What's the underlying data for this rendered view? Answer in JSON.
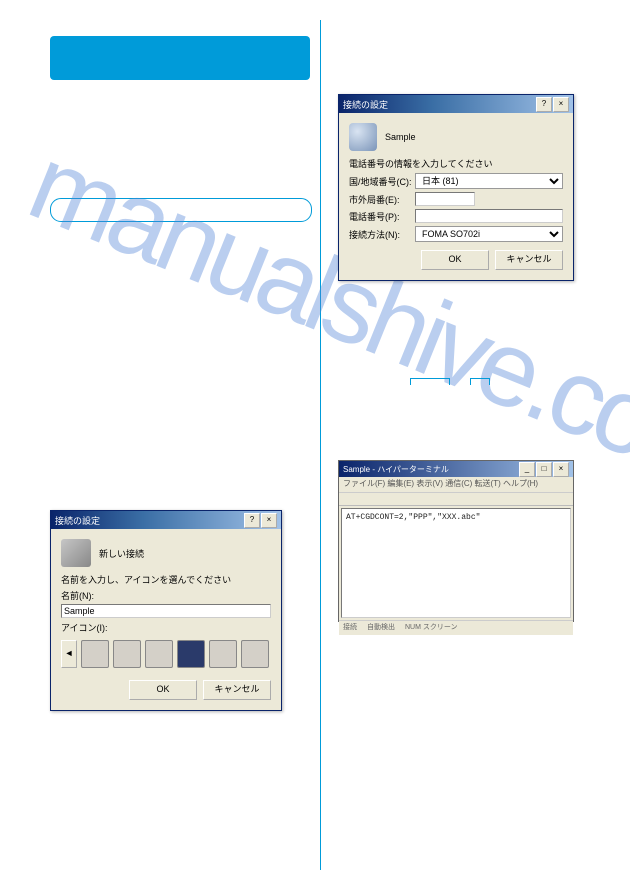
{
  "watermark": "manualshive.com",
  "dialog1": {
    "title": "接続の設定",
    "header": "新しい接続",
    "instruction": "名前を入力し、アイコンを選んでください",
    "name_label": "名前(N):",
    "name_value": "Sample",
    "icon_label": "アイコン(I):",
    "ok": "OK",
    "cancel": "キャンセル"
  },
  "dialog2": {
    "title": "接続の設定",
    "header": "Sample",
    "instruction": "電話番号の情報を入力してください",
    "country_label": "国/地域番号(C):",
    "country_value": "日本 (81)",
    "areacode_label": "市外局番(E):",
    "areacode_value": "",
    "phone_label": "電話番号(P):",
    "phone_value": "",
    "connect_label": "接続方法(N):",
    "connect_value": "FOMA SO702i",
    "ok": "OK",
    "cancel": "キャンセル"
  },
  "terminal": {
    "title": "Sample - ハイパーターミナル",
    "menu": "ファイル(F)  編集(E)  表示(V)  通信(C)  転送(T)  ヘルプ(H)",
    "command": "AT+CGDCONT=2,\"PPP\",\"XXX.abc\"",
    "status1": "接続",
    "status2": "自動検出",
    "status3": "NUM スクリーン"
  }
}
